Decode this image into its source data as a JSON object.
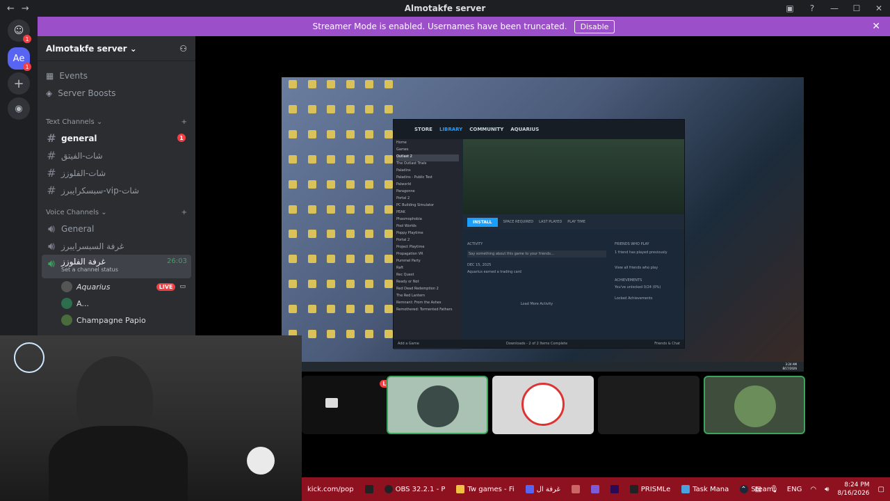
{
  "window": {
    "title": "Almotakfe server"
  },
  "banner": {
    "text": "Streamer Mode is enabled. Usernames have been truncated.",
    "button": "Disable"
  },
  "guilds": {
    "dm_badge": "1",
    "server_initials": "Ae",
    "server_badge": "1"
  },
  "server": {
    "name": "Almotakfe server",
    "events": "Events",
    "boosts": "Server Boosts",
    "text_category": "Text Channels",
    "text_channels": [
      {
        "name": "general",
        "badge": "1"
      },
      {
        "name": "شات-الفيتق"
      },
      {
        "name": "شات-الفلوزز"
      },
      {
        "name": "سبسكرايبرز-vip-شات"
      }
    ],
    "voice_category": "Voice Channels",
    "voice_channels": [
      {
        "name": "General"
      },
      {
        "name": "غرفة السبسرايبرز"
      },
      {
        "name": "غرفة الفلوزز",
        "timer": "26:03",
        "status": "Set a channel status"
      }
    ],
    "voice_users": [
      {
        "name": "Aquarius",
        "badge": "LIVE"
      },
      {
        "name": "A..."
      },
      {
        "name": "Champagne Papio"
      }
    ]
  },
  "stream": {
    "steam": {
      "tabs": [
        "STORE",
        "LIBRARY",
        "COMMUNITY",
        "AQUARIUS"
      ],
      "home": "Home",
      "games_filter": "Games",
      "games": [
        "Outlast 2",
        "The Outlast Trials",
        "Paladins",
        "Paladins - Public Test",
        "Palworld",
        "Paragonne",
        "Portal 2",
        "PC Building Simulator",
        "PEAK",
        "Phasmophobia",
        "Pool Worlds",
        "Poppy Playtime",
        "Portal 2",
        "Project Playtime",
        "Propagation VR",
        "Pummel Party",
        "Raft",
        "Rec Quest",
        "Ready or Not",
        "Red Dead Redemption 2",
        "The Red Lantern",
        "Remnant: From the Ashes",
        "Remothered: Tormented Fathers"
      ],
      "install": "INSTALL",
      "space_required": "SPACE REQUIRED",
      "last_played": "LAST PLAYED",
      "play_time": "PLAY TIME",
      "activity": "ACTIVITY",
      "activity_placeholder": "Say something about this game to your friends...",
      "date": "DEC 15, 2025",
      "event": "Aquarius earned a trading card",
      "load_more": "Load More Activity",
      "friends_who_play": "FRIENDS WHO PLAY",
      "friends_text": "1 friend has played previously",
      "view_all": "View all friends who play",
      "achievements": "ACHIEVEMENTS",
      "ach_text": "You've unlocked 0/24 (0%)",
      "locked": "Locked Achievements",
      "add_game": "Add a Game",
      "downloads": "Downloads - 2 of 2 Items Complete",
      "friends_chat": "Friends & Chat"
    },
    "win_clock": [
      "3:24 AM",
      "8/17/2026"
    ]
  },
  "tiles": {
    "live": "LIVE"
  },
  "taskbar": {
    "items": [
      {
        "label": "kick.com/pop"
      },
      {
        "label": "OBS 32.2.1 - P"
      },
      {
        "label": "Tw games - Fi"
      },
      {
        "label": "غرفة ال"
      },
      {
        "label": "PRISMLe"
      },
      {
        "label": "Task Mana"
      },
      {
        "label": "Steam"
      }
    ],
    "lang": "ENG",
    "time": "8:24 PM",
    "date": "8/16/2026"
  },
  "colors": {
    "banner": "#9b4fc8",
    "taskbar": "#8e1120",
    "accent_green": "#3ba55c",
    "live_red": "#f23f43"
  }
}
